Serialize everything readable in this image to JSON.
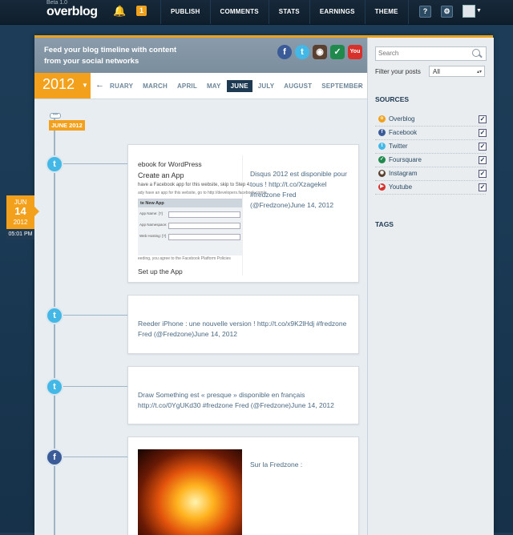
{
  "topbar": {
    "logo_beta": "Beta 1.0",
    "logo_name": "overblog",
    "alert_count": "1",
    "nav": [
      "PUBLISH",
      "COMMENTS",
      "STATS",
      "EARNINGS",
      "THEME"
    ],
    "help_label": "?",
    "settings_label": "⚙"
  },
  "promo": {
    "text": "Feed your blog timeline with content from your social networks"
  },
  "yearbar": {
    "year": "2012",
    "months": [
      "RUARY",
      "MARCH",
      "APRIL",
      "MAY",
      "JUNE",
      "JULY",
      "AUGUST",
      "SEPTEMBER"
    ],
    "active_month": "JUNE",
    "prev_arrow": "←",
    "next_arrow": "→"
  },
  "timeline": {
    "month_tag": "JUNE 2012",
    "date_badge": {
      "month": "JUN",
      "day": "14",
      "year": "2012",
      "time": "05:01 PM"
    },
    "posts": [
      {
        "source": "Twitter",
        "text": "Disqus 2012 est disponible pour tous ! http://t.co/Xzagekel #fredzone Fred (@Fredzone)June 14, 2012",
        "preview": {
          "title": "ebook for WordPress",
          "heading": "Create an App",
          "line1": "have a Facebook app for this website, skip to Step 4.",
          "line2": "ady have an app for this website, go to http://developers.facebook.com/a",
          "shot_header": "te New App",
          "rows": [
            "App Name: [?]",
            "App Namespace: [?]",
            "Web Hosting: [?]"
          ],
          "footnote": "eeding, you agree to the Facebook Platform Policies",
          "caption": "Set up the App"
        }
      },
      {
        "source": "Twitter",
        "text": "Reeder iPhone : une nouvelle version ! http://t.co/x9K2lHdj #fredzone Fred (@Fredzone)June 14, 2012"
      },
      {
        "source": "Twitter",
        "text": "Draw Something est « presque » disponible en français http://t.co/0YgUKd30 #fredzone Fred (@Fredzone)June 14, 2012"
      },
      {
        "source": "Facebook",
        "text": "Sur la Fredzone :"
      }
    ]
  },
  "sidebar": {
    "search_placeholder": "Search",
    "filter_label": "Filter your posts",
    "filter_value": "All",
    "sources_heading": "SOURCES",
    "sources": [
      {
        "label": "Overblog",
        "color": "#f0a21c",
        "checked": true
      },
      {
        "label": "Facebook",
        "color": "#3a5a98",
        "checked": true
      },
      {
        "label": "Twitter",
        "color": "#43b8e6",
        "checked": true
      },
      {
        "label": "Foursquare",
        "color": "#1f8a4c",
        "checked": true
      },
      {
        "label": "Instagram",
        "color": "#5b4030",
        "checked": true
      },
      {
        "label": "Youtube",
        "color": "#d8312b",
        "checked": true
      }
    ],
    "tags_heading": "TAGS"
  },
  "colors": {
    "accent": "#f3a11c",
    "navy": "#1e3a52",
    "twitter": "#43b8e6",
    "facebook": "#3a5a98"
  }
}
